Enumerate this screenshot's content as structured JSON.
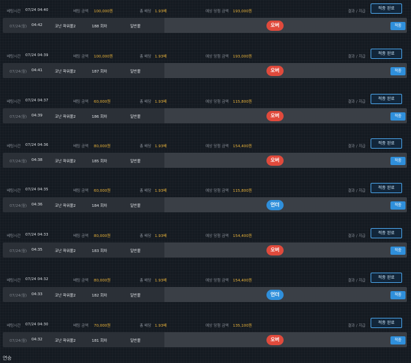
{
  "labels": {
    "bet_time": "베팅시간",
    "bet_amount": "베팅 금액",
    "total_odds": "총 배당",
    "expected_win": "예상 당첨 금액",
    "result_pay": "결과 / 지급",
    "done": "적중 완료",
    "hit": "적중"
  },
  "colors": {
    "over": "#e04a3c",
    "under": "#2f8fdb",
    "amount": "#e8b23a"
  },
  "bets": [
    {
      "bet_time": "07/24 04:40",
      "amount": "100,000원",
      "odds": "1.93배",
      "expected": "193,000원",
      "date": "07/24(월)",
      "game_time": "04:42",
      "game": "코난 파워볼2",
      "round": "188 회차",
      "kind": "일반볼",
      "pick": "오버",
      "pick_color": "#e04a3c"
    },
    {
      "bet_time": "07/24 04:39",
      "amount": "100,000원",
      "odds": "1.93배",
      "expected": "193,000원",
      "date": "07/24(월)",
      "game_time": "04:41",
      "game": "코난 파워볼2",
      "round": "187 회차",
      "kind": "일반볼",
      "pick": "오버",
      "pick_color": "#e04a3c"
    },
    {
      "bet_time": "07/24 04:37",
      "amount": "60,000원",
      "odds": "1.93배",
      "expected": "115,800원",
      "date": "07/24(월)",
      "game_time": "04:39",
      "game": "코난 파워볼2",
      "round": "186 회차",
      "kind": "일반볼",
      "pick": "오버",
      "pick_color": "#e04a3c"
    },
    {
      "bet_time": "07/24 04:36",
      "amount": "80,000원",
      "odds": "1.93배",
      "expected": "154,400원",
      "date": "07/24(월)",
      "game_time": "04:38",
      "game": "코난 파워볼2",
      "round": "185 회차",
      "kind": "일반볼",
      "pick": "오버",
      "pick_color": "#e04a3c"
    },
    {
      "bet_time": "07/24 04:35",
      "amount": "60,000원",
      "odds": "1.93배",
      "expected": "115,800원",
      "date": "07/24(월)",
      "game_time": "04:36",
      "game": "코난 파워볼2",
      "round": "184 회차",
      "kind": "일반볼",
      "pick": "언더",
      "pick_color": "#2f8fdb"
    },
    {
      "bet_time": "07/24 04:33",
      "amount": "80,000원",
      "odds": "1.93배",
      "expected": "154,400원",
      "date": "07/24(월)",
      "game_time": "04:35",
      "game": "코난 파워볼2",
      "round": "183 회차",
      "kind": "일반볼",
      "pick": "오버",
      "pick_color": "#e04a3c"
    },
    {
      "bet_time": "07/24 04:32",
      "amount": "80,000원",
      "odds": "1.93배",
      "expected": "154,400원",
      "date": "07/24(월)",
      "game_time": "04:33",
      "game": "코난 파워볼2",
      "round": "182 회차",
      "kind": "일반볼",
      "pick": "언더",
      "pick_color": "#2f8fdb"
    },
    {
      "bet_time": "07/24 04:30",
      "amount": "70,000원",
      "odds": "1.93배",
      "expected": "135,100원",
      "date": "07/24(월)",
      "game_time": "04:32",
      "game": "코난 파워볼2",
      "round": "181 회차",
      "kind": "일반볼",
      "pick": "오버",
      "pick_color": "#e04a3c"
    }
  ],
  "footer": {
    "label": "연승"
  }
}
